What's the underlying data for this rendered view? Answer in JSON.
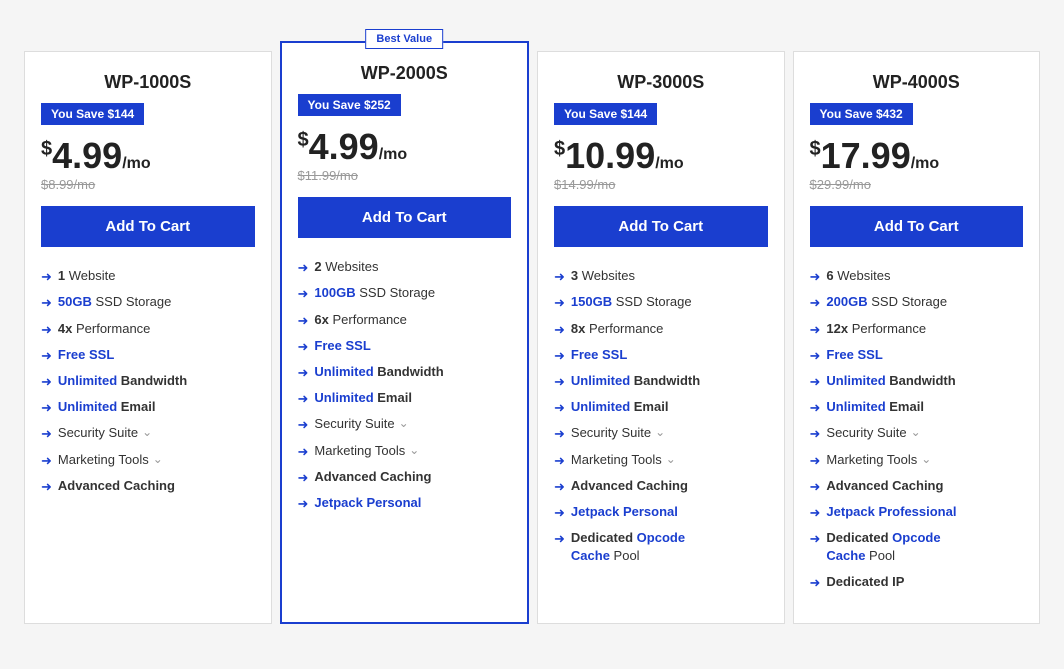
{
  "plans": [
    {
      "id": "wp-1000s",
      "name": "WP-1000S",
      "featured": false,
      "best_value": false,
      "savings": "You Save $144",
      "price": "4.99",
      "price_dollar": "$",
      "price_suffix": "/mo",
      "original_price": "$8.99/mo",
      "add_to_cart": "Add To Cart",
      "features": [
        {
          "text": "1 Website",
          "bold_part": "1",
          "type": "normal"
        },
        {
          "text": "50GB SSD Storage",
          "bold_part": "50GB",
          "type": "blue-bold-prefix"
        },
        {
          "text": "4x Performance",
          "bold_part": "4x",
          "type": "normal"
        },
        {
          "text": "Free SSL",
          "type": "all-blue"
        },
        {
          "text": "Unlimited Bandwidth",
          "blue_part": "Unlimited",
          "type": "blue-prefix"
        },
        {
          "text": "Unlimited Email",
          "blue_part": "Unlimited",
          "type": "blue-prefix"
        },
        {
          "text": "Security Suite",
          "type": "normal-chevron"
        },
        {
          "text": "Marketing Tools",
          "type": "normal-chevron"
        },
        {
          "text": "Advanced Caching",
          "type": "bold-only"
        }
      ]
    },
    {
      "id": "wp-2000s",
      "name": "WP-2000S",
      "featured": true,
      "best_value": true,
      "best_value_label": "Best Value",
      "savings": "You Save $252",
      "price": "4.99",
      "price_dollar": "$",
      "price_suffix": "/mo",
      "original_price": "$11.99/mo",
      "add_to_cart": "Add To Cart",
      "features": [
        {
          "text": "2 Websites",
          "bold_part": "2",
          "type": "normal"
        },
        {
          "text": "100GB SSD Storage",
          "bold_part": "100GB",
          "type": "blue-bold-prefix"
        },
        {
          "text": "6x Performance",
          "bold_part": "6x",
          "type": "normal"
        },
        {
          "text": "Free SSL",
          "type": "all-blue"
        },
        {
          "text": "Unlimited Bandwidth",
          "blue_part": "Unlimited",
          "type": "blue-prefix"
        },
        {
          "text": "Unlimited Email",
          "blue_part": "Unlimited",
          "type": "blue-prefix"
        },
        {
          "text": "Security Suite",
          "type": "normal-chevron"
        },
        {
          "text": "Marketing Tools",
          "type": "normal-chevron"
        },
        {
          "text": "Advanced Caching",
          "type": "bold-only"
        },
        {
          "text": "Jetpack Personal",
          "type": "all-blue-bold"
        }
      ]
    },
    {
      "id": "wp-3000s",
      "name": "WP-3000S",
      "featured": false,
      "best_value": false,
      "savings": "You Save $144",
      "price": "10.99",
      "price_dollar": "$",
      "price_suffix": "/mo",
      "original_price": "$14.99/mo",
      "add_to_cart": "Add To Cart",
      "features": [
        {
          "text": "3 Websites",
          "bold_part": "3",
          "type": "normal"
        },
        {
          "text": "150GB SSD Storage",
          "bold_part": "150GB",
          "type": "blue-bold-prefix"
        },
        {
          "text": "8x Performance",
          "bold_part": "8x",
          "type": "normal"
        },
        {
          "text": "Free SSL",
          "type": "all-blue"
        },
        {
          "text": "Unlimited Bandwidth",
          "blue_part": "Unlimited",
          "type": "blue-prefix"
        },
        {
          "text": "Unlimited Email",
          "blue_part": "Unlimited",
          "type": "blue-prefix"
        },
        {
          "text": "Security Suite",
          "type": "normal-chevron"
        },
        {
          "text": "Marketing Tools",
          "type": "normal-chevron"
        },
        {
          "text": "Advanced Caching",
          "type": "bold-only"
        },
        {
          "text": "Jetpack Personal",
          "type": "all-blue-bold"
        },
        {
          "text": "Dedicated Opcode Cache Pool",
          "bold_parts": [
            "Dedicated",
            "Cache",
            "Pool"
          ],
          "opcode_blue": "Opcode",
          "type": "dedicated-opcode"
        }
      ]
    },
    {
      "id": "wp-4000s",
      "name": "WP-4000S",
      "featured": false,
      "best_value": false,
      "savings": "You Save $432",
      "price": "17.99",
      "price_dollar": "$",
      "price_suffix": "/mo",
      "original_price": "$29.99/mo",
      "add_to_cart": "Add To Cart",
      "features": [
        {
          "text": "6 Websites",
          "bold_part": "6",
          "type": "normal"
        },
        {
          "text": "200GB SSD Storage",
          "bold_part": "200GB",
          "type": "blue-bold-prefix"
        },
        {
          "text": "12x Performance",
          "bold_part": "12x",
          "type": "normal"
        },
        {
          "text": "Free SSL",
          "type": "all-blue"
        },
        {
          "text": "Unlimited Bandwidth",
          "blue_part": "Unlimited",
          "type": "blue-prefix"
        },
        {
          "text": "Unlimited Email",
          "blue_part": "Unlimited",
          "type": "blue-prefix"
        },
        {
          "text": "Security Suite",
          "type": "normal-chevron"
        },
        {
          "text": "Marketing Tools",
          "type": "normal-chevron"
        },
        {
          "text": "Advanced Caching",
          "type": "bold-only"
        },
        {
          "text": "Jetpack Professional",
          "type": "all-blue-bold"
        },
        {
          "text": "Dedicated Opcode Cache Pool",
          "type": "dedicated-opcode"
        },
        {
          "text": "Dedicated IP",
          "type": "bold-only"
        }
      ]
    }
  ]
}
